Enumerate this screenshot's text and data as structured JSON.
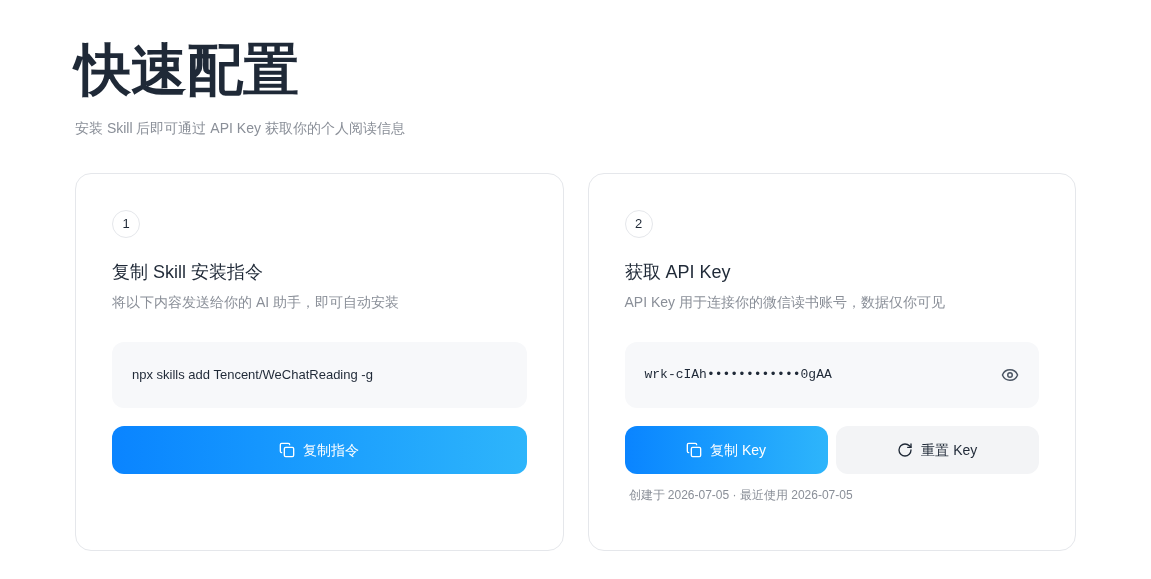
{
  "title": "快速配置",
  "subtitle": "安装 Skill 后即可通过 API Key 获取你的个人阅读信息",
  "cards": [
    {
      "step": "1",
      "heading": "复制 Skill 安装指令",
      "description": "将以下内容发送给你的 AI 助手，即可自动安装",
      "code": {
        "text": "npx skills add Tencent/WeChatReading -g",
        "kind": "command"
      },
      "buttons": [
        {
          "label": "复制指令",
          "kind": "primary"
        }
      ]
    },
    {
      "step": "2",
      "heading": "获取 API Key",
      "description": "API Key 用于连接你的微信读书账号，数据仅你可见",
      "code": {
        "text": "wrk-cIAh••••••••••••0gAA",
        "kind": "secret"
      },
      "buttons": [
        {
          "label": "复制 Key",
          "kind": "primary"
        },
        {
          "label": "重置 Key",
          "kind": "secondary"
        }
      ],
      "meta": "创建于 2026-07-05 · 最近使用 2026-07-05"
    }
  ]
}
